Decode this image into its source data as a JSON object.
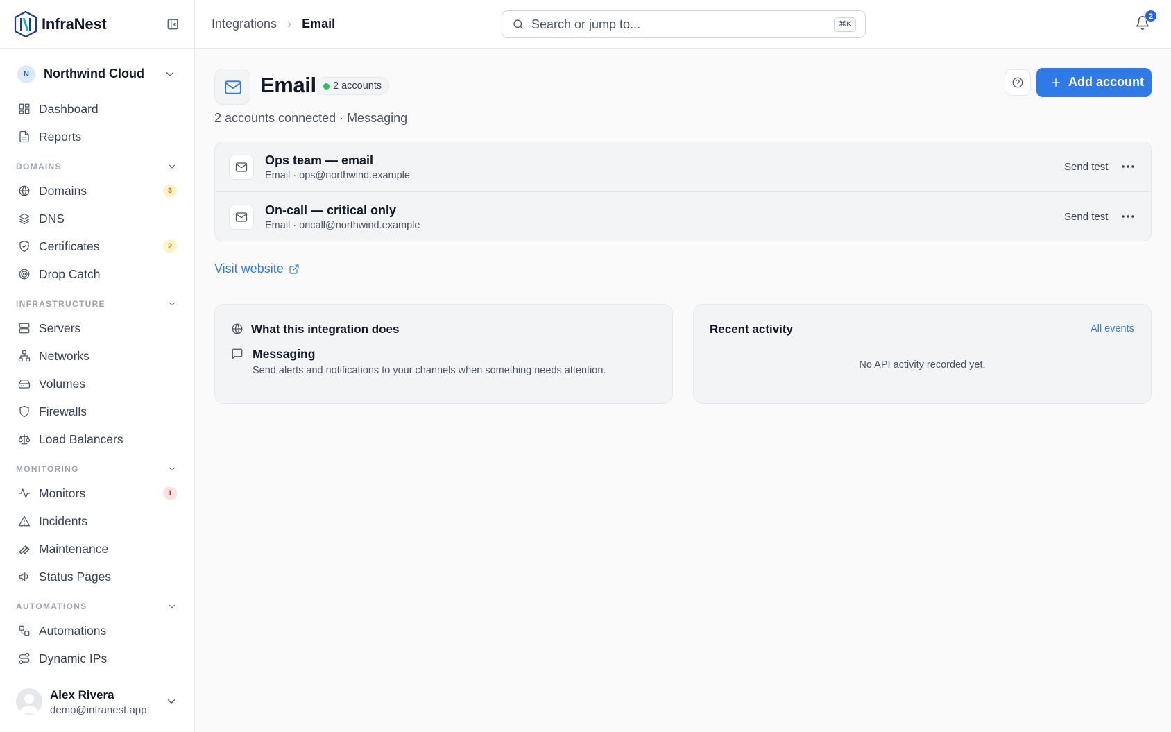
{
  "app": {
    "name": "InfraNest"
  },
  "org": {
    "initial": "N",
    "name": "Northwind Cloud"
  },
  "sidebar": {
    "top_items": [
      {
        "label": "Dashboard",
        "icon": "dashboard-icon"
      },
      {
        "label": "Reports",
        "icon": "file-icon"
      }
    ],
    "sections": [
      {
        "title": "DOMAINS",
        "items": [
          {
            "label": "Domains",
            "icon": "globe-icon",
            "count": "3",
            "count_color": "#d97706"
          },
          {
            "label": "DNS",
            "icon": "layers-icon"
          },
          {
            "label": "Certificates",
            "icon": "shield-check-icon",
            "count": "2",
            "count_color": "#d97706"
          },
          {
            "label": "Drop Catch",
            "icon": "target-icon"
          }
        ]
      },
      {
        "title": "INFRASTRUCTURE",
        "items": [
          {
            "label": "Servers",
            "icon": "server-icon"
          },
          {
            "label": "Networks",
            "icon": "network-icon"
          },
          {
            "label": "Volumes",
            "icon": "hard-drive-icon"
          },
          {
            "label": "Firewalls",
            "icon": "shield-icon"
          },
          {
            "label": "Load Balancers",
            "icon": "scale-icon"
          }
        ]
      },
      {
        "title": "MONITORING",
        "items": [
          {
            "label": "Monitors",
            "icon": "activity-icon",
            "count": "1",
            "count_color": "#dc2626"
          },
          {
            "label": "Incidents",
            "icon": "alert-triangle-icon"
          },
          {
            "label": "Maintenance",
            "icon": "wrench-icon"
          },
          {
            "label": "Status Pages",
            "icon": "megaphone-icon"
          }
        ]
      },
      {
        "title": "AUTOMATIONS",
        "items": [
          {
            "label": "Automations",
            "icon": "workflow-icon"
          },
          {
            "label": "Dynamic IPs",
            "icon": "route-icon"
          }
        ]
      }
    ]
  },
  "user": {
    "name": "Alex Rivera",
    "email": "demo@infranest.app"
  },
  "topbar": {
    "breadcrumb": {
      "parent": "Integrations",
      "current": "Email"
    },
    "search": {
      "placeholder": "Search or jump to...",
      "shortcut": "⌘K"
    },
    "notifications": {
      "count": "2"
    }
  },
  "header": {
    "title": "Email",
    "status": "2 accounts",
    "subtitle": "2 accounts connected · Messaging",
    "add_label": "Add account"
  },
  "accounts": [
    {
      "name": "Ops team — email",
      "detail": "Email · ops@northwind.example",
      "action": "Send test"
    },
    {
      "name": "On-call — critical only",
      "detail": "Email · oncall@northwind.example",
      "action": "Send test"
    }
  ],
  "visit_link": "Visit website",
  "about": {
    "title": "What this integration does",
    "feature_title": "Messaging",
    "feature_desc": "Send alerts and notifications to your channels when something needs attention."
  },
  "activity": {
    "title": "Recent activity",
    "link": "All events",
    "empty": "No API activity recorded yet."
  },
  "colors": {
    "accent": "#2f7ae5",
    "status_ok": "#22c55e"
  }
}
